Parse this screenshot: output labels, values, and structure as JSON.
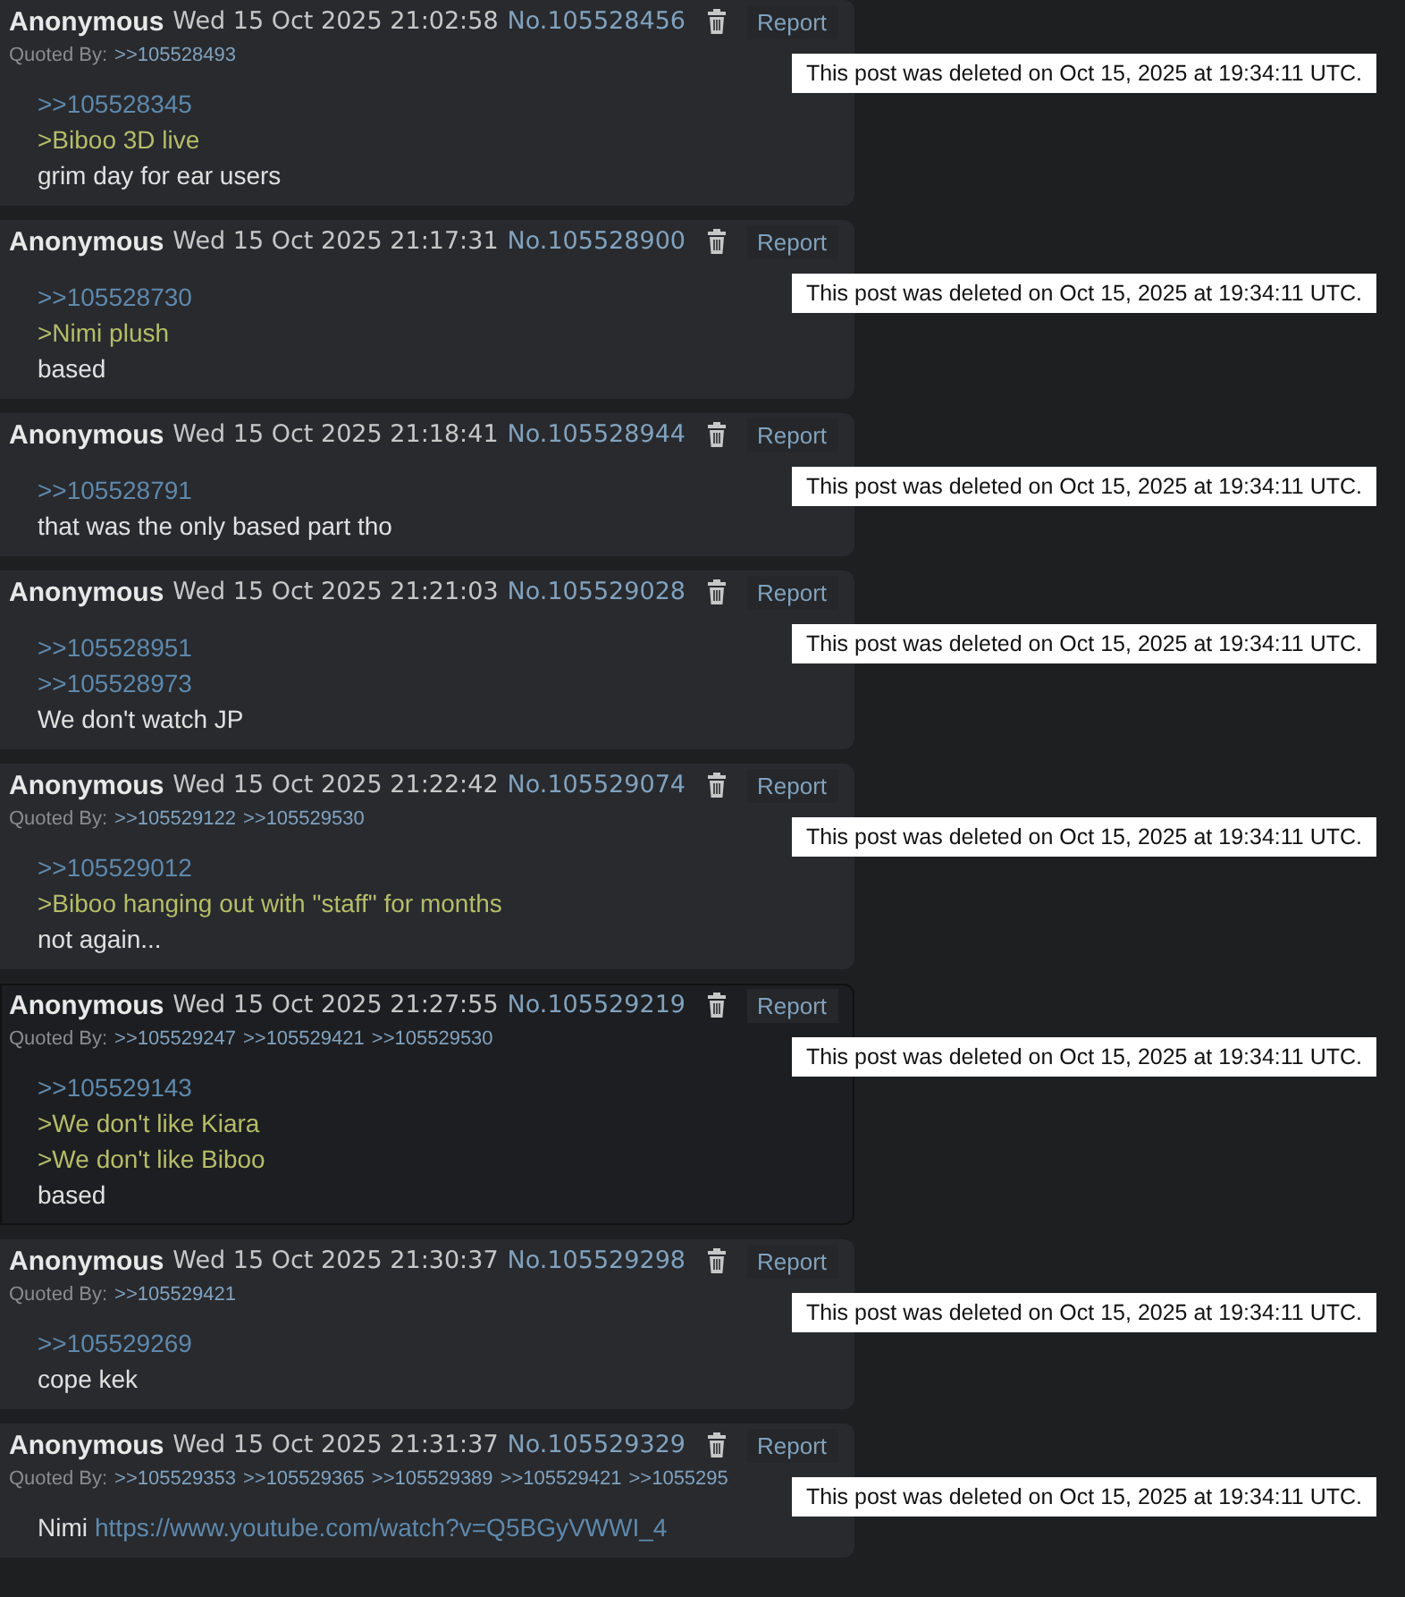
{
  "posts": [
    {
      "name": "Anonymous",
      "date": "Wed 15 Oct 2025 21:02:58",
      "number": "No.105528456",
      "report": "Report",
      "highlighted": false,
      "quoted_by_label": "Quoted By:",
      "quoted_by": [
        ">>105528493"
      ],
      "lines": [
        {
          "kind": "quote",
          "text": ">>105528345"
        },
        {
          "kind": "greentext",
          "text": ">Biboo 3D live"
        },
        {
          "kind": "text",
          "text": "grim day for ear users"
        }
      ],
      "notice": "This post was deleted on Oct 15, 2025 at 19:34:11 UTC."
    },
    {
      "name": "Anonymous",
      "date": "Wed 15 Oct 2025 21:17:31",
      "number": "No.105528900",
      "report": "Report",
      "highlighted": false,
      "lines": [
        {
          "kind": "quote",
          "text": ">>105528730"
        },
        {
          "kind": "greentext",
          "text": ">Nimi plush"
        },
        {
          "kind": "text",
          "text": "based"
        }
      ],
      "notice": "This post was deleted on Oct 15, 2025 at 19:34:11 UTC."
    },
    {
      "name": "Anonymous",
      "date": "Wed 15 Oct 2025 21:18:41",
      "number": "No.105528944",
      "report": "Report",
      "highlighted": false,
      "lines": [
        {
          "kind": "quote",
          "text": ">>105528791"
        },
        {
          "kind": "text",
          "text": "that was the only based part tho"
        }
      ],
      "notice": "This post was deleted on Oct 15, 2025 at 19:34:11 UTC."
    },
    {
      "name": "Anonymous",
      "date": "Wed 15 Oct 2025 21:21:03",
      "number": "No.105529028",
      "report": "Report",
      "highlighted": false,
      "lines": [
        {
          "kind": "quote",
          "text": ">>105528951"
        },
        {
          "kind": "quote",
          "text": ">>105528973"
        },
        {
          "kind": "text",
          "text": "We don't watch JP"
        }
      ],
      "notice": "This post was deleted on Oct 15, 2025 at 19:34:11 UTC."
    },
    {
      "name": "Anonymous",
      "date": "Wed 15 Oct 2025 21:22:42",
      "number": "No.105529074",
      "report": "Report",
      "highlighted": false,
      "quoted_by_label": "Quoted By:",
      "quoted_by": [
        ">>105529122",
        ">>105529530"
      ],
      "lines": [
        {
          "kind": "quote",
          "text": ">>105529012"
        },
        {
          "kind": "greentext",
          "text": ">Biboo hanging out with \"staff\" for months"
        },
        {
          "kind": "text",
          "text": "not again..."
        }
      ],
      "notice": "This post was deleted on Oct 15, 2025 at 19:34:11 UTC."
    },
    {
      "name": "Anonymous",
      "date": "Wed 15 Oct 2025 21:27:55",
      "number": "No.105529219",
      "report": "Report",
      "highlighted": true,
      "quoted_by_label": "Quoted By:",
      "quoted_by": [
        ">>105529247",
        ">>105529421",
        ">>105529530"
      ],
      "lines": [
        {
          "kind": "quote",
          "text": ">>105529143"
        },
        {
          "kind": "greentext",
          "text": ">We don't like Kiara"
        },
        {
          "kind": "greentext",
          "text": ">We don't like Biboo"
        },
        {
          "kind": "text",
          "text": "based"
        }
      ],
      "notice": "This post was deleted on Oct 15, 2025 at 19:34:11 UTC."
    },
    {
      "name": "Anonymous",
      "date": "Wed 15 Oct 2025 21:30:37",
      "number": "No.105529298",
      "report": "Report",
      "highlighted": false,
      "quoted_by_label": "Quoted By:",
      "quoted_by": [
        ">>105529421"
      ],
      "lines": [
        {
          "kind": "quote",
          "text": ">>105529269"
        },
        {
          "kind": "text",
          "text": "cope kek"
        }
      ],
      "notice": "This post was deleted on Oct 15, 2025 at 19:34:11 UTC."
    },
    {
      "name": "Anonymous",
      "date": "Wed 15 Oct 2025 21:31:37",
      "number": "No.105529329",
      "report": "Report",
      "highlighted": false,
      "quoted_by_label": "Quoted By:",
      "quoted_by": [
        ">>105529353",
        ">>105529365",
        ">>105529389",
        ">>105529421",
        ">>1055295"
      ],
      "lines": [
        {
          "kind": "text",
          "text": "Nimi",
          "link": "https://www.youtube.com/watch?v=Q5BGyVWWI_4"
        }
      ],
      "notice": "This post was deleted on Oct 15, 2025 at 19:34:11 UTC."
    }
  ]
}
